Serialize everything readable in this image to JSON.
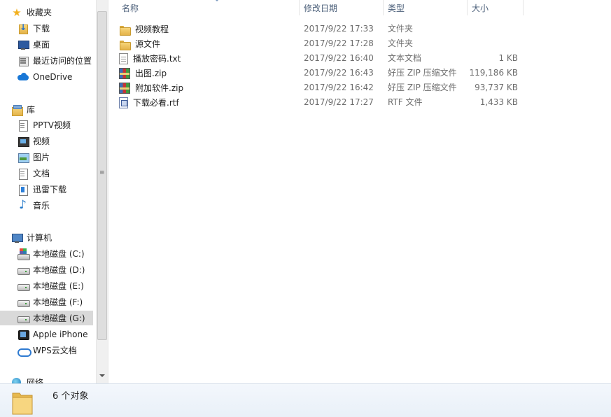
{
  "nav": {
    "favorites": {
      "label": "收藏夹",
      "items": [
        {
          "label": "下载",
          "icon": "download-folder-icon"
        },
        {
          "label": "桌面",
          "icon": "desktop-icon"
        },
        {
          "label": "最近访问的位置",
          "icon": "recent-places-icon"
        },
        {
          "label": "OneDrive",
          "icon": "onedrive-cloud-icon"
        }
      ]
    },
    "libraries": {
      "label": "库",
      "items": [
        {
          "label": "PPTV视频",
          "icon": "document-icon"
        },
        {
          "label": "视频",
          "icon": "video-icon"
        },
        {
          "label": "图片",
          "icon": "picture-icon"
        },
        {
          "label": "文档",
          "icon": "document-icon"
        },
        {
          "label": "迅雷下载",
          "icon": "thunder-download-icon"
        },
        {
          "label": "音乐",
          "icon": "music-icon"
        }
      ]
    },
    "computer": {
      "label": "计算机",
      "items": [
        {
          "label": "本地磁盘 (C:)",
          "icon": "system-disk-icon"
        },
        {
          "label": "本地磁盘 (D:)",
          "icon": "disk-icon"
        },
        {
          "label": "本地磁盘 (E:)",
          "icon": "disk-icon"
        },
        {
          "label": "本地磁盘 (F:)",
          "icon": "disk-icon"
        },
        {
          "label": "本地磁盘 (G:)",
          "icon": "disk-icon",
          "selected": true
        },
        {
          "label": "Apple iPhone",
          "icon": "iphone-icon"
        },
        {
          "label": "WPS云文档",
          "icon": "wps-cloud-icon"
        }
      ]
    },
    "network": {
      "label": "网络"
    }
  },
  "columns": {
    "name": "名称",
    "date": "修改日期",
    "type": "类型",
    "size": "大小"
  },
  "files": [
    {
      "name": "视频教程",
      "date": "2017/9/22 17:33",
      "type": "文件夹",
      "size": "",
      "icon": "folder-icon"
    },
    {
      "name": "源文件",
      "date": "2017/9/22 17:28",
      "type": "文件夹",
      "size": "",
      "icon": "folder-icon"
    },
    {
      "name": "播放密码.txt",
      "date": "2017/9/22 16:40",
      "type": "文本文档",
      "size": "1 KB",
      "icon": "text-file-icon"
    },
    {
      "name": "出图.zip",
      "date": "2017/9/22 16:43",
      "type": "好压 ZIP 压缩文件",
      "size": "119,186 KB",
      "icon": "zip-archive-icon"
    },
    {
      "name": "附加软件.zip",
      "date": "2017/9/22 16:42",
      "type": "好压 ZIP 压缩文件",
      "size": "93,737 KB",
      "icon": "zip-archive-icon"
    },
    {
      "name": "下载必看.rtf",
      "date": "2017/9/22 17:27",
      "type": "RTF 文件",
      "size": "1,433 KB",
      "icon": "rtf-file-icon"
    }
  ],
  "status": {
    "count": "6 个对象"
  }
}
